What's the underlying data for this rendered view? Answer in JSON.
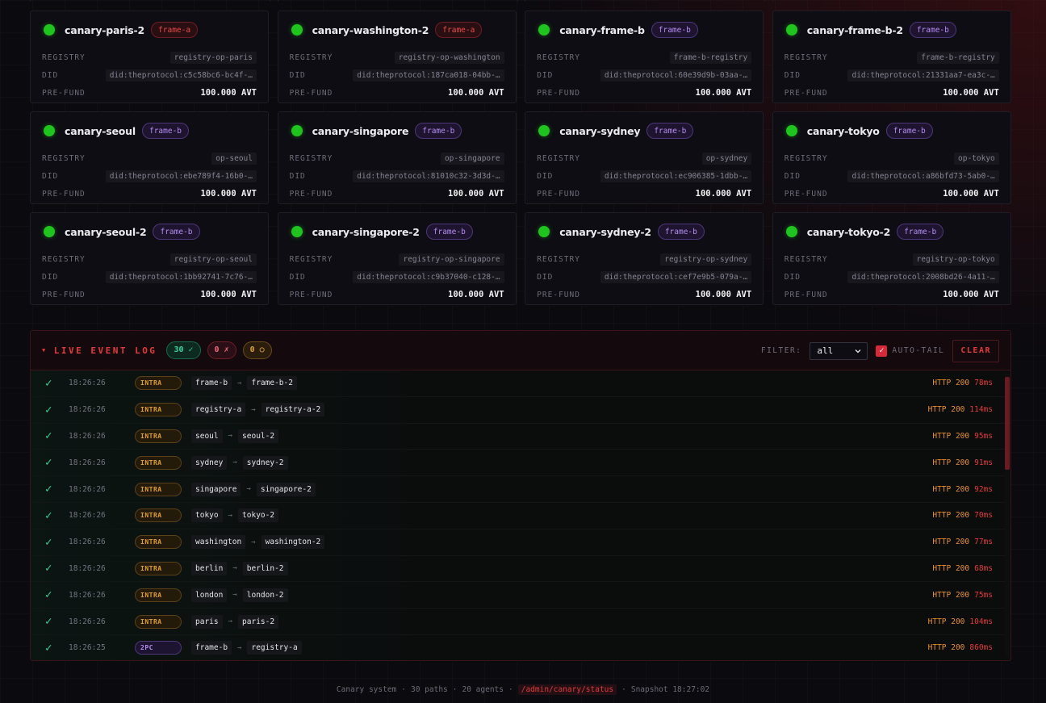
{
  "cards": [
    {
      "name": "canary-paris-2",
      "frame": "frame-a",
      "frame_class": "frame-a",
      "registry": "registry-op-paris",
      "did": "did:theprotocol:c5c58bc6-bc4f-…",
      "prefund": "100.000 AVT"
    },
    {
      "name": "canary-washington-2",
      "frame": "frame-a",
      "frame_class": "frame-a",
      "registry": "registry-op-washington",
      "did": "did:theprotocol:187ca018-04bb-…",
      "prefund": "100.000 AVT"
    },
    {
      "name": "canary-frame-b",
      "frame": "frame-b",
      "frame_class": "frame-b",
      "registry": "frame-b-registry",
      "did": "did:theprotocol:60e39d9b-03aa-…",
      "prefund": "100.000 AVT"
    },
    {
      "name": "canary-frame-b-2",
      "frame": "frame-b",
      "frame_class": "frame-b",
      "registry": "frame-b-registry",
      "did": "did:theprotocol:21331aa7-ea3c-…",
      "prefund": "100.000 AVT"
    },
    {
      "name": "canary-seoul",
      "frame": "frame-b",
      "frame_class": "frame-b",
      "registry": "op-seoul",
      "did": "did:theprotocol:ebe789f4-16b0-…",
      "prefund": "100.000 AVT"
    },
    {
      "name": "canary-singapore",
      "frame": "frame-b",
      "frame_class": "frame-b",
      "registry": "op-singapore",
      "did": "did:theprotocol:81010c32-3d3d-…",
      "prefund": "100.000 AVT"
    },
    {
      "name": "canary-sydney",
      "frame": "frame-b",
      "frame_class": "frame-b",
      "registry": "op-sydney",
      "did": "did:theprotocol:ec906385-1dbb-…",
      "prefund": "100.000 AVT"
    },
    {
      "name": "canary-tokyo",
      "frame": "frame-b",
      "frame_class": "frame-b",
      "registry": "op-tokyo",
      "did": "did:theprotocol:a86bfd73-5ab0-…",
      "prefund": "100.000 AVT"
    },
    {
      "name": "canary-seoul-2",
      "frame": "frame-b",
      "frame_class": "frame-b",
      "registry": "registry-op-seoul",
      "did": "did:theprotocol:1bb92741-7c76-…",
      "prefund": "100.000 AVT"
    },
    {
      "name": "canary-singapore-2",
      "frame": "frame-b",
      "frame_class": "frame-b",
      "registry": "registry-op-singapore",
      "did": "did:theprotocol:c9b37040-c128-…",
      "prefund": "100.000 AVT"
    },
    {
      "name": "canary-sydney-2",
      "frame": "frame-b",
      "frame_class": "frame-b",
      "registry": "registry-op-sydney",
      "did": "did:theprotocol:cef7e9b5-079a-…",
      "prefund": "100.000 AVT"
    },
    {
      "name": "canary-tokyo-2",
      "frame": "frame-b",
      "frame_class": "frame-b",
      "registry": "registry-op-tokyo",
      "did": "did:theprotocol:2008bd26-4a11-…",
      "prefund": "100.000 AVT"
    }
  ],
  "card_labels": {
    "registry": "REGISTRY",
    "did": "DID",
    "prefund": "PRE-FUND"
  },
  "log": {
    "title": "LIVE EVENT LOG",
    "count_ok": "30 ✓",
    "count_fail": "0 ✗",
    "count_pending": "0 ○",
    "filter_label": "FILTER:",
    "filter_value": "all",
    "autotail_label": "AUTO-TAIL",
    "clear_label": "CLEAR",
    "events": [
      {
        "time": "18:26:26",
        "kind": "INTRA",
        "kind_class": "intra",
        "from": "frame-b",
        "to": "frame-b-2",
        "http": "HTTP 200",
        "ms": "78ms"
      },
      {
        "time": "18:26:26",
        "kind": "INTRA",
        "kind_class": "intra",
        "from": "registry-a",
        "to": "registry-a-2",
        "http": "HTTP 200",
        "ms": "114ms"
      },
      {
        "time": "18:26:26",
        "kind": "INTRA",
        "kind_class": "intra",
        "from": "seoul",
        "to": "seoul-2",
        "http": "HTTP 200",
        "ms": "95ms"
      },
      {
        "time": "18:26:26",
        "kind": "INTRA",
        "kind_class": "intra",
        "from": "sydney",
        "to": "sydney-2",
        "http": "HTTP 200",
        "ms": "91ms"
      },
      {
        "time": "18:26:26",
        "kind": "INTRA",
        "kind_class": "intra",
        "from": "singapore",
        "to": "singapore-2",
        "http": "HTTP 200",
        "ms": "92ms"
      },
      {
        "time": "18:26:26",
        "kind": "INTRA",
        "kind_class": "intra",
        "from": "tokyo",
        "to": "tokyo-2",
        "http": "HTTP 200",
        "ms": "70ms"
      },
      {
        "time": "18:26:26",
        "kind": "INTRA",
        "kind_class": "intra",
        "from": "washington",
        "to": "washington-2",
        "http": "HTTP 200",
        "ms": "77ms"
      },
      {
        "time": "18:26:26",
        "kind": "INTRA",
        "kind_class": "intra",
        "from": "berlin",
        "to": "berlin-2",
        "http": "HTTP 200",
        "ms": "68ms"
      },
      {
        "time": "18:26:26",
        "kind": "INTRA",
        "kind_class": "intra",
        "from": "london",
        "to": "london-2",
        "http": "HTTP 200",
        "ms": "75ms"
      },
      {
        "time": "18:26:26",
        "kind": "INTRA",
        "kind_class": "intra",
        "from": "paris",
        "to": "paris-2",
        "http": "HTTP 200",
        "ms": "104ms"
      },
      {
        "time": "18:26:25",
        "kind": "2PC",
        "kind_class": "twopc",
        "from": "frame-b",
        "to": "registry-a",
        "http": "HTTP 200",
        "ms": "860ms"
      }
    ]
  },
  "footer": {
    "system": "Canary system",
    "paths": "30 paths",
    "agents": "20 agents",
    "endpoint": "/admin/canary/status",
    "snapshot": "Snapshot 18:27:02"
  },
  "colors": {
    "ok": "#1fc41f",
    "accent": "#e23a3a",
    "frame_a": "#e84a4a",
    "frame_b": "#b58cf0",
    "http": "#e8902a"
  }
}
